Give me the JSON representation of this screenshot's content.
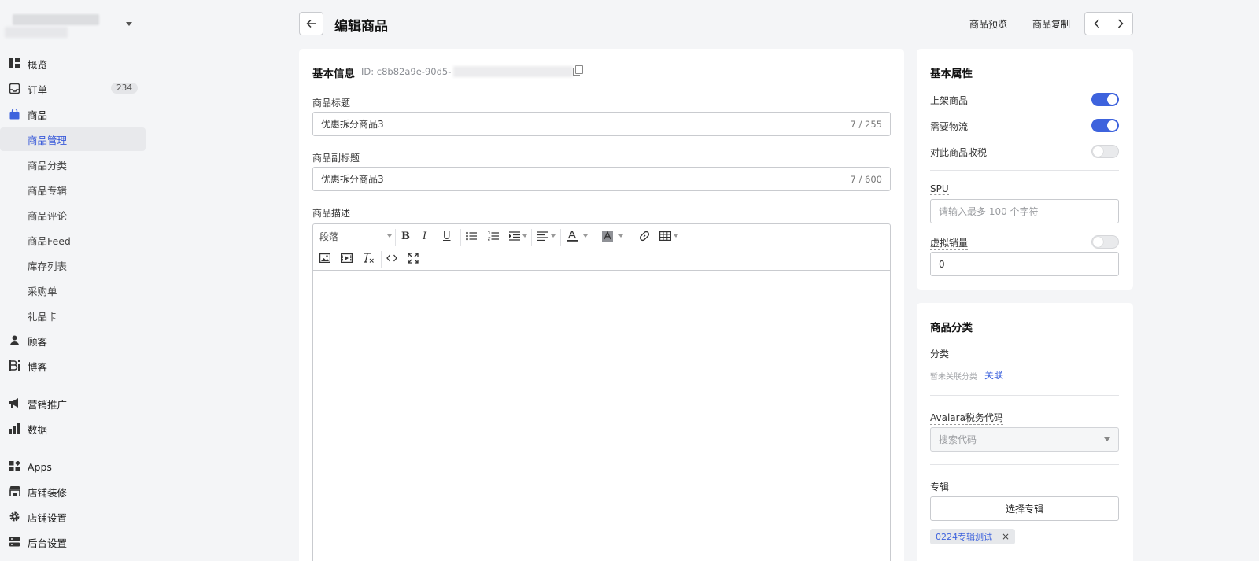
{
  "sidebar": {
    "items": [
      {
        "label": "概览",
        "icon": "overview-icon"
      },
      {
        "label": "订单",
        "icon": "inbox-icon",
        "badge": "234"
      },
      {
        "label": "商品",
        "icon": "bag-icon"
      },
      {
        "label": "商品管理",
        "active": true
      },
      {
        "label": "商品分类"
      },
      {
        "label": "商品专辑"
      },
      {
        "label": "商品评论"
      },
      {
        "label": "商品Feed"
      },
      {
        "label": "库存列表"
      },
      {
        "label": "采购单"
      },
      {
        "label": "礼品卡"
      },
      {
        "label": "顾客",
        "icon": "person-icon"
      },
      {
        "label": "博客",
        "icon": "blog-icon"
      },
      {
        "label": "营销推广",
        "icon": "megaphone-icon"
      },
      {
        "label": "数据",
        "icon": "bar-chart-icon"
      },
      {
        "label": "Apps",
        "icon": "apps-icon"
      },
      {
        "label": "店铺装修",
        "icon": "store-icon"
      },
      {
        "label": "店铺设置",
        "icon": "gear-icon"
      },
      {
        "label": "后台设置",
        "icon": "server-icon"
      }
    ]
  },
  "header": {
    "title": "编辑商品",
    "preview_link": "商品预览",
    "copy_link": "商品复制"
  },
  "basic": {
    "section_title": "基本信息",
    "id_prefix": "ID: c8b82a9e-90d5-",
    "title_label": "商品标题",
    "title_value": "优惠拆分商品3",
    "title_counter": "7 / 255",
    "subtitle_label": "商品副标题",
    "subtitle_value": "优惠拆分商品3",
    "subtitle_counter": "7 / 600",
    "desc_label": "商品描述",
    "paragraph_select": "段落"
  },
  "attributes": {
    "section_title": "基本属性",
    "on_shelf_label": "上架商品",
    "on_shelf": true,
    "shipping_label": "需要物流",
    "shipping": true,
    "tax_label": "对此商品收税",
    "tax": false,
    "spu_label": "SPU",
    "spu_placeholder": "请输入最多 100 个字符",
    "virtual_sales_label": "虚拟销量",
    "virtual_sales_enabled": false,
    "virtual_sales_value": "0"
  },
  "category": {
    "section_title": "商品分类",
    "category_label": "分类",
    "no_category_text": "暂未关联分类",
    "link_label": "关联",
    "avalara_label": "Avalara税务代码",
    "avalara_placeholder": "搜索代码",
    "collection_label": "专辑",
    "choose_collection": "选择专辑",
    "collection_chip": "0224专辑测试",
    "chip_remove": "×"
  },
  "colors": {
    "accent": "#3e63dd",
    "page_bg": "#f4f5f7"
  }
}
